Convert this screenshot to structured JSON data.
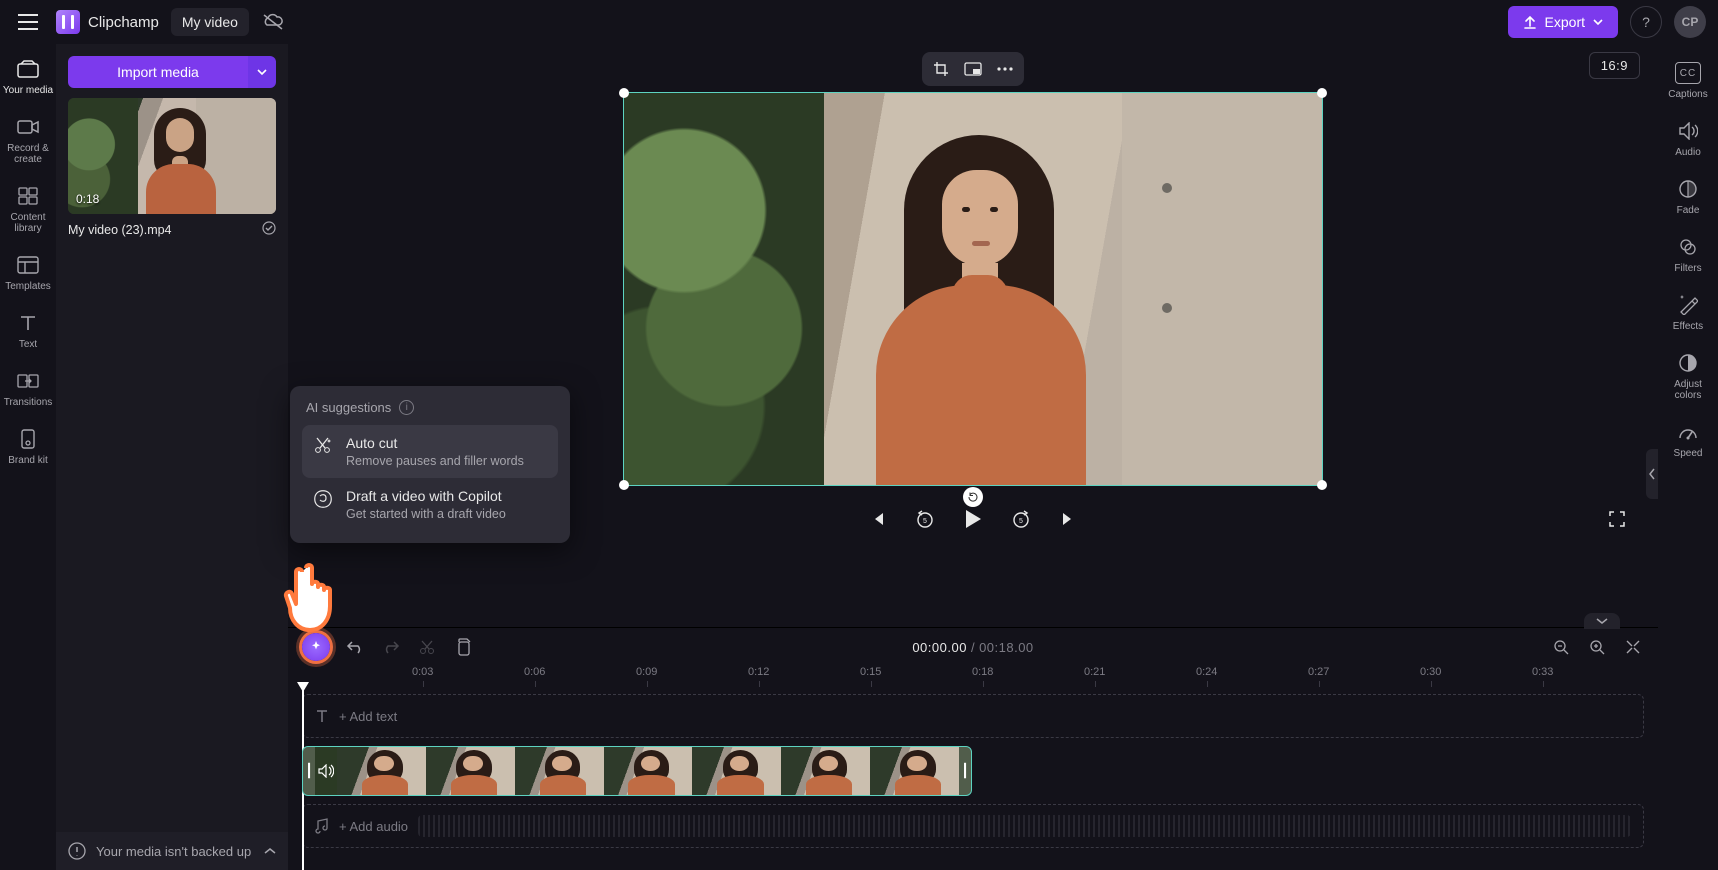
{
  "app": {
    "name": "Clipchamp",
    "project_title": "My video"
  },
  "topbar": {
    "export_label": "Export",
    "avatar_initials": "CP"
  },
  "sidebar_left": {
    "items": [
      {
        "label": "Your media"
      },
      {
        "label": "Record & create"
      },
      {
        "label": "Content library"
      },
      {
        "label": "Templates"
      },
      {
        "label": "Text"
      },
      {
        "label": "Transitions"
      },
      {
        "label": "Brand kit"
      }
    ]
  },
  "media_panel": {
    "import_label": "Import media",
    "clip": {
      "duration": "0:18",
      "filename": "My video (23).mp4"
    }
  },
  "sidebar_right": {
    "items": [
      {
        "label": "Captions"
      },
      {
        "label": "Audio"
      },
      {
        "label": "Fade"
      },
      {
        "label": "Filters"
      },
      {
        "label": "Effects"
      },
      {
        "label": "Adjust colors"
      },
      {
        "label": "Speed"
      }
    ]
  },
  "preview": {
    "aspect_ratio": "16:9"
  },
  "timeline": {
    "current_time": "00:00.00",
    "total_time": "00:18.00",
    "ticks": [
      "0:03",
      "0:06",
      "0:09",
      "0:12",
      "0:15",
      "0:18",
      "0:21",
      "0:24",
      "0:27",
      "0:30",
      "0:33"
    ],
    "add_text_label": "+ Add text",
    "add_audio_label": "+ Add audio"
  },
  "ai_popup": {
    "header": "AI suggestions",
    "options": [
      {
        "title": "Auto cut",
        "subtitle": "Remove pauses and filler words"
      },
      {
        "title": "Draft a video with Copilot",
        "subtitle": "Get started with a draft video"
      }
    ]
  },
  "footer": {
    "backup_msg": "Your media isn't backed up"
  }
}
